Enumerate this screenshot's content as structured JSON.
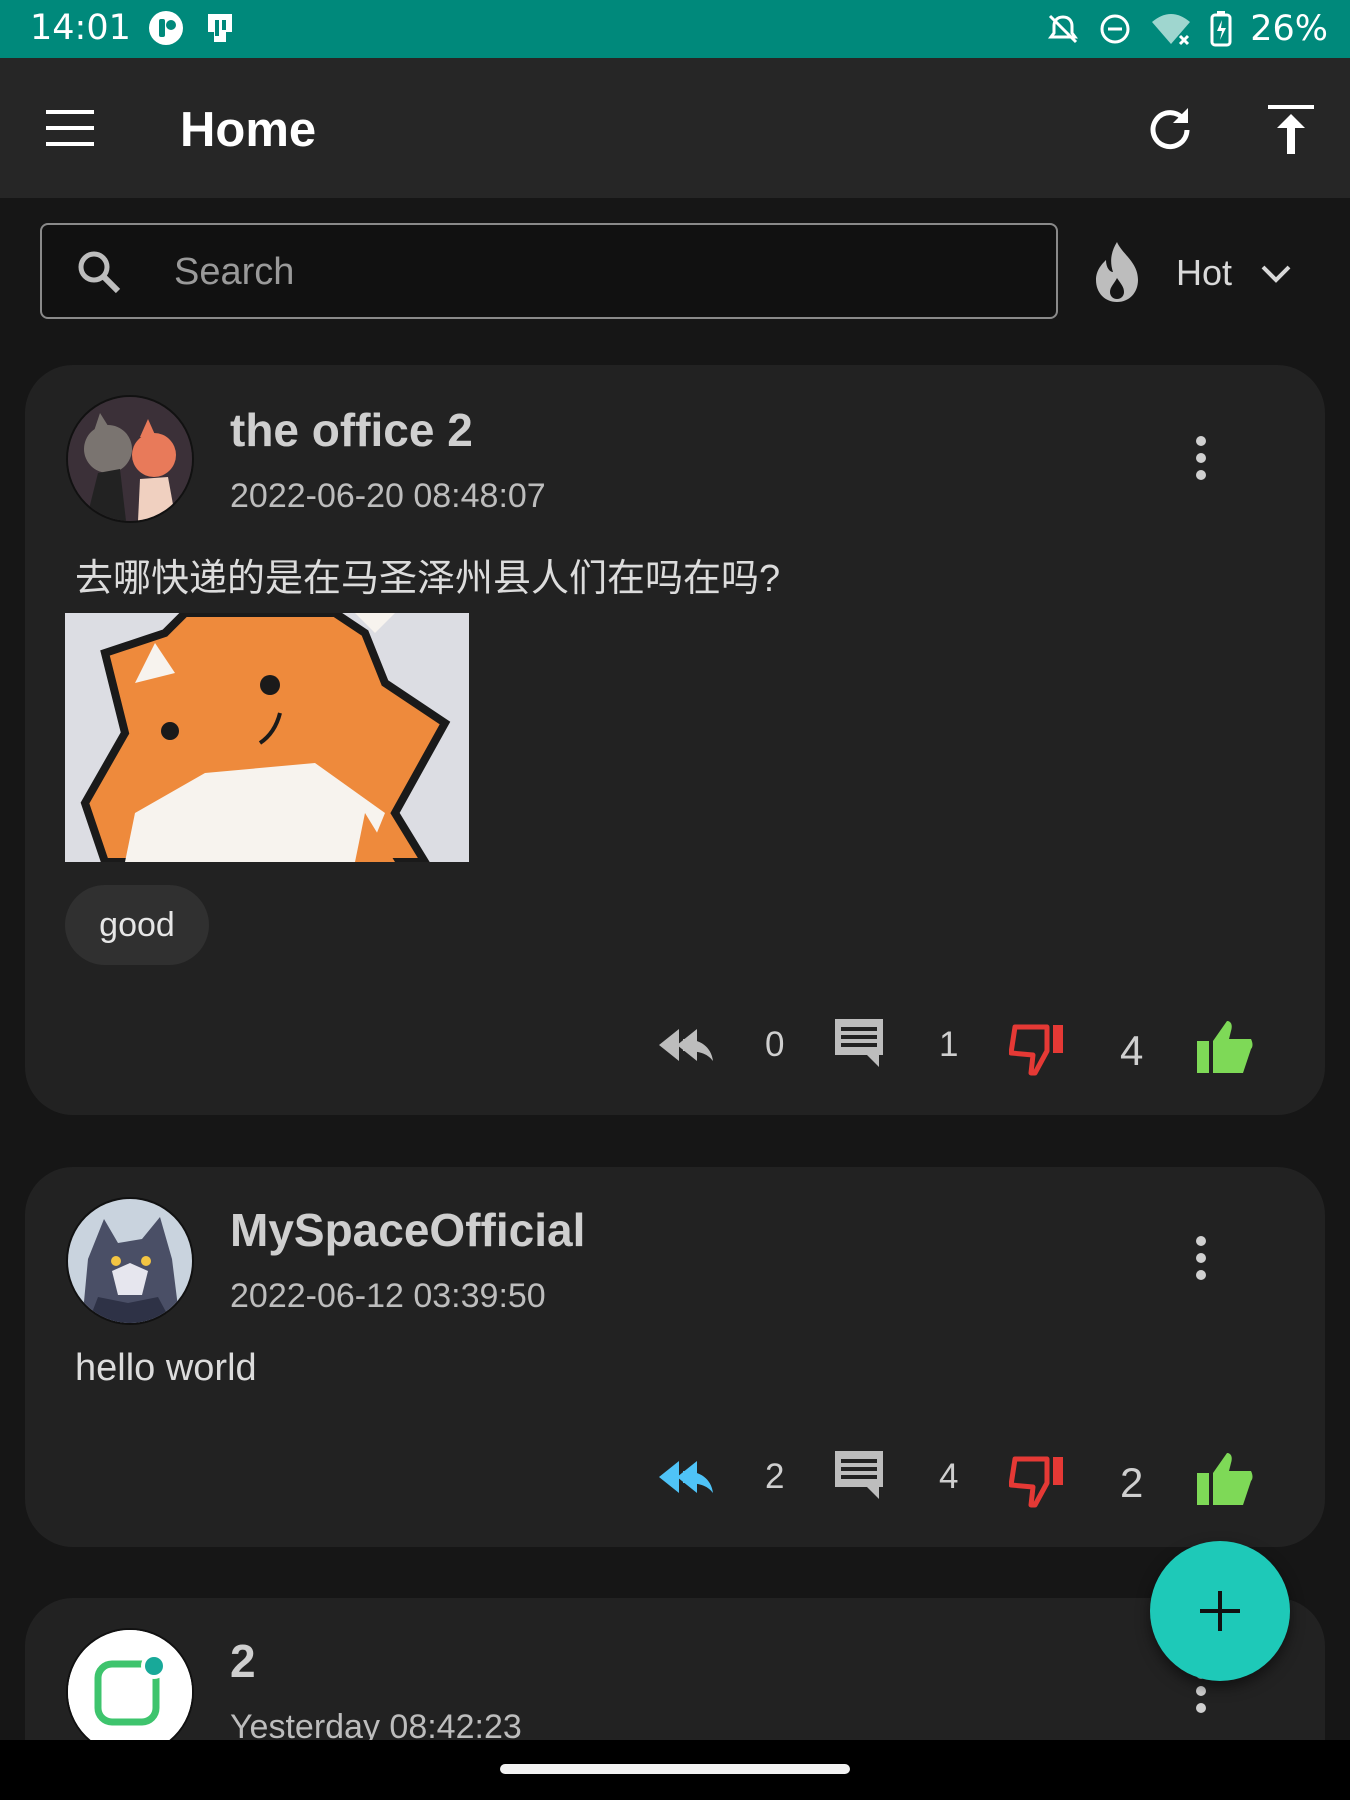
{
  "status_bar": {
    "time": "14:01",
    "left_icons": [
      "app-notification-icon",
      "sim-card-icon"
    ],
    "right_icons": [
      "notifications-off-icon",
      "do-not-disturb-icon",
      "wifi-off-icon",
      "battery-charging-icon"
    ],
    "battery": "26%"
  },
  "app_bar": {
    "title": "Home",
    "icons": [
      "menu-icon",
      "refresh-icon",
      "scroll-to-top-icon"
    ]
  },
  "search": {
    "placeholder": "Search",
    "value": ""
  },
  "sort": {
    "label": "Hot",
    "icon": "flame-icon"
  },
  "posts": [
    {
      "author": "the office 2",
      "time": "2022-06-20 08:48:07",
      "body": "去哪快递的是在马圣泽州县人们在吗在吗?",
      "tag": "good",
      "repost_count": "0",
      "comment_count": "1",
      "score": "4"
    },
    {
      "author": "MySpaceOfficial",
      "time": "2022-06-12 03:39:50",
      "body": "hello world",
      "repost_count": "2",
      "comment_count": "4",
      "score": "2"
    },
    {
      "author": "2",
      "time": "Yesterday 08:42:23"
    }
  ],
  "colors": {
    "status_bar": "#00897b",
    "app_bar": "#262626",
    "background": "#161616",
    "card": "#222222",
    "dislike": "#e53935",
    "like": "#7ed957",
    "repost_active": "#4fc3f7",
    "fab": "#1ec9b8"
  },
  "fab": {
    "icon": "plus-icon"
  }
}
